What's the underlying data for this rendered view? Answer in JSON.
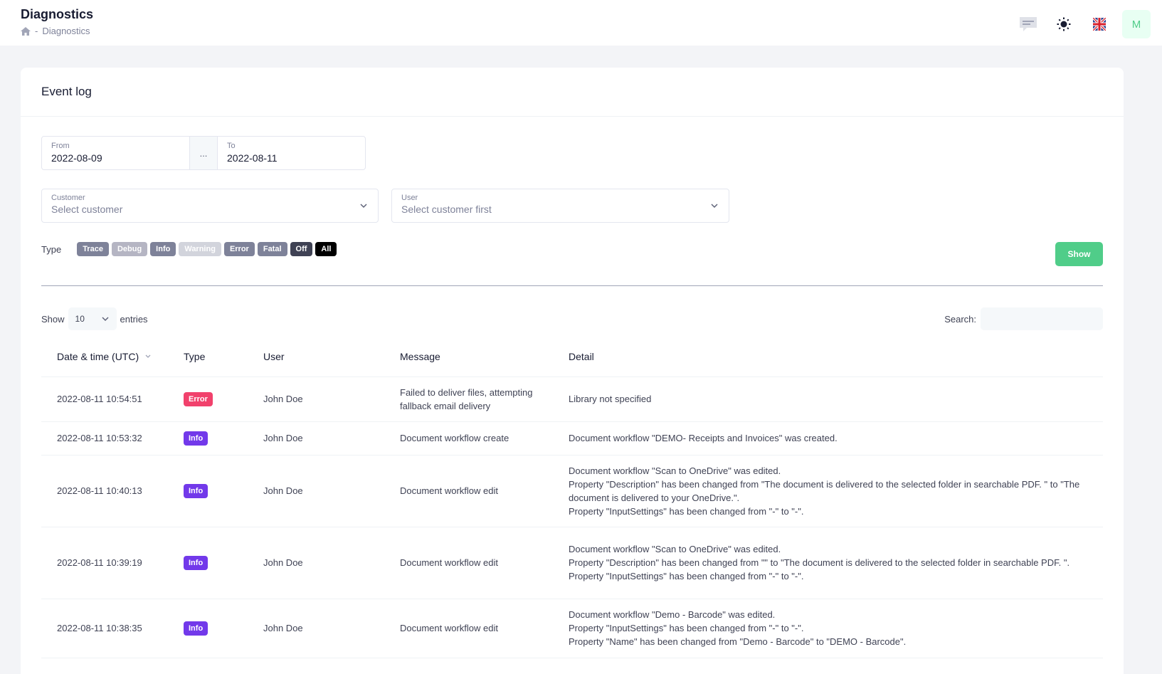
{
  "header": {
    "title": "Diagnostics",
    "breadcrumb_sep": "-",
    "breadcrumb_current": "Diagnostics",
    "avatar_initial": "M",
    "icons": [
      "home-icon",
      "chat-icon",
      "sun-icon",
      "uk-flag-icon"
    ]
  },
  "card": {
    "title": "Event log"
  },
  "filters": {
    "from_label": "From",
    "from_value": "2022-08-09",
    "range_sep": "...",
    "to_label": "To",
    "to_value": "2022-08-11",
    "customer_label": "Customer",
    "customer_value": "Select customer",
    "user_label": "User",
    "user_value": "Select customer first",
    "type_label": "Type",
    "types": [
      {
        "label": "Trace",
        "color": "#7e8299"
      },
      {
        "label": "Debug",
        "color": "#b5b5c3"
      },
      {
        "label": "Info",
        "color": "#7e8299"
      },
      {
        "label": "Warning",
        "color": "#d2d4dc"
      },
      {
        "label": "Error",
        "color": "#7e8299"
      },
      {
        "label": "Fatal",
        "color": "#7e8299"
      },
      {
        "label": "Off",
        "color": "#3f4254"
      },
      {
        "label": "All",
        "color": "#000000"
      }
    ],
    "show_button": "Show"
  },
  "table_controls": {
    "show_label": "Show",
    "page_size": "10",
    "entries_label": "entries",
    "search_label": "Search:"
  },
  "table": {
    "columns": [
      "Date & time (UTC)",
      "Type",
      "User",
      "Message",
      "Detail"
    ],
    "rows": [
      {
        "datetime": "2022-08-11 10:54:51",
        "type": "Error",
        "type_color": "#f1416c",
        "user": "John Doe",
        "message": "Failed to deliver files, attempting fallback email delivery",
        "detail": [
          "Library not specified"
        ]
      },
      {
        "datetime": "2022-08-11 10:53:32",
        "type": "Info",
        "type_color": "#7239ea",
        "user": "John Doe",
        "message": "Document workflow create",
        "detail": [
          "Document workflow \"DEMO- Receipts and Invoices\" was created."
        ]
      },
      {
        "datetime": "2022-08-11 10:40:13",
        "type": "Info",
        "type_color": "#7239ea",
        "user": "John Doe",
        "message": "Document workflow edit",
        "detail": [
          "Document workflow \"Scan to OneDrive\" was edited.",
          "Property \"Description\" has been changed from \"The document is delivered to the selected folder in searchable PDF. \" to \"The document is delivered to your OneDrive.\".",
          "Property \"InputSettings\" has been changed from \"-\" to \"-\"."
        ]
      },
      {
        "datetime": "2022-08-11 10:39:19",
        "type": "Info",
        "type_color": "#7239ea",
        "user": "John Doe",
        "message": "Document workflow edit",
        "detail": [
          "Document workflow \"Scan to OneDrive\" was edited.",
          "Property \"Description\" has been changed from \"\" to \"The document is delivered to the selected folder in searchable PDF. \".",
          "Property \"InputSettings\" has been changed from \"-\" to \"-\"."
        ]
      },
      {
        "datetime": "2022-08-11 10:38:35",
        "type": "Info",
        "type_color": "#7239ea",
        "user": "John Doe",
        "message": "Document workflow edit",
        "detail": [
          "Document workflow \"Demo - Barcode\" was edited.",
          "Property \"InputSettings\" has been changed from \"-\" to \"-\".",
          "Property \"Name\" has been changed from \"Demo - Barcode\" to \"DEMO - Barcode\"."
        ]
      }
    ]
  }
}
